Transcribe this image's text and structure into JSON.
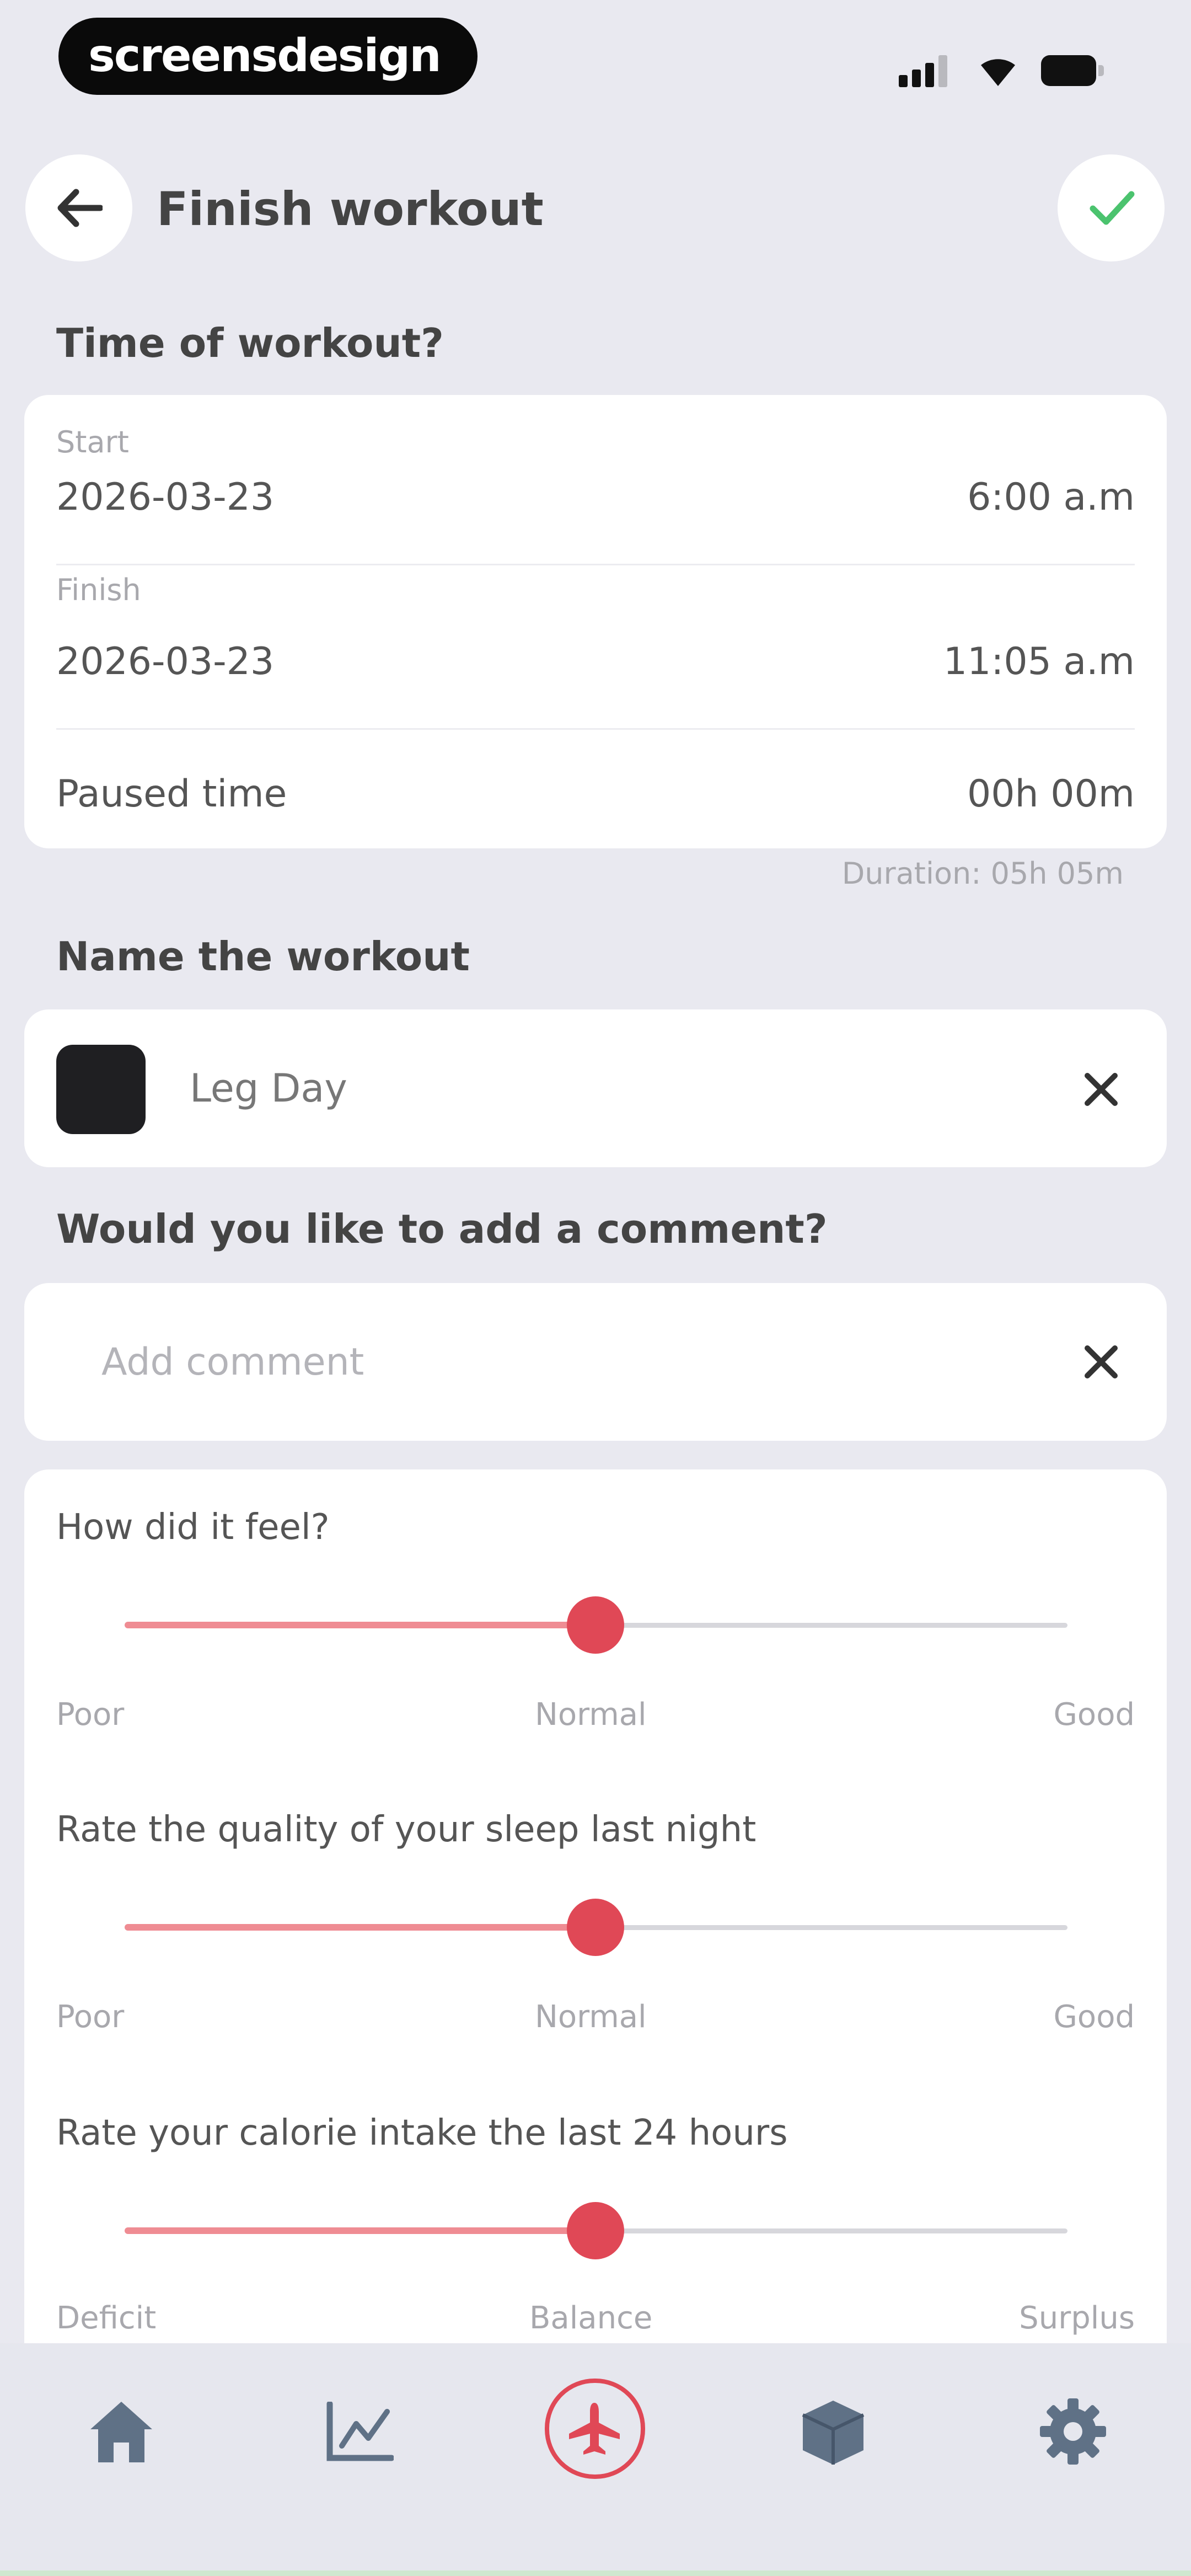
{
  "status_bar": {
    "brand": "screensdesign"
  },
  "header": {
    "title": "Finish workout"
  },
  "time_section": {
    "title": "Time of workout?",
    "start_label": "Start",
    "start_date": "2026-03-23",
    "start_time": "6:00 a.m",
    "finish_label": "Finish",
    "finish_date": "2026-03-23",
    "finish_time": "11:05 a.m",
    "paused_label": "Paused time",
    "paused_value": "00h 00m",
    "duration": "Duration: 05h 05m"
  },
  "name_section": {
    "title": "Name the workout",
    "value": "Leg Day"
  },
  "comment_section": {
    "title": "Would you like to add a comment?",
    "placeholder": "Add comment"
  },
  "ratings": [
    {
      "question": "How did it feel?",
      "low": "Poor",
      "mid": "Normal",
      "high": "Good",
      "level": 0.5
    },
    {
      "question": "Rate the quality of your sleep last night",
      "low": "Poor",
      "mid": "Normal",
      "high": "Good",
      "level": 0.5
    },
    {
      "question": "Rate your calorie intake the last 24 hours",
      "low": "Deficit",
      "mid": "Balance",
      "high": "Surplus",
      "level": 0.5
    }
  ],
  "tab_bar": {
    "items": [
      "home-icon",
      "progress-chart-icon",
      "workout-plane-icon",
      "box-icon",
      "settings-gear-icon"
    ],
    "active": "workout-plane-icon",
    "accent": "#e04856",
    "icon_color": "#5f7186"
  }
}
